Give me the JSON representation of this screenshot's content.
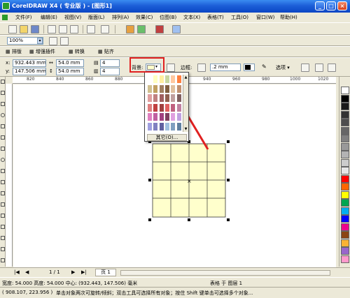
{
  "window": {
    "title": "CorelDRAW X4 ( 专业版 ) - [图形1]",
    "min_label": "_",
    "max_label": "□",
    "close_label": "×"
  },
  "menu": [
    {
      "label": "文件(F)",
      "name": "menu-file"
    },
    {
      "label": "编辑(E)",
      "name": "menu-edit"
    },
    {
      "label": "视图(V)",
      "name": "menu-view"
    },
    {
      "label": "版面(L)",
      "name": "menu-layout"
    },
    {
      "label": "排列(A)",
      "name": "menu-arrange"
    },
    {
      "label": "效果(C)",
      "name": "menu-effects"
    },
    {
      "label": "位图(B)",
      "name": "menu-bitmaps"
    },
    {
      "label": "文本(X)",
      "name": "menu-text"
    },
    {
      "label": "表格(T)",
      "name": "menu-table"
    },
    {
      "label": "工具(O)",
      "name": "menu-tools"
    },
    {
      "label": "窗口(W)",
      "name": "menu-window"
    },
    {
      "label": "帮助(H)",
      "name": "menu-help"
    }
  ],
  "zoom": {
    "value": "100%"
  },
  "table_toolbar": {
    "btn1": "排版",
    "btn2": "增强插件",
    "btn3": "转换",
    "btn4": "贴齐"
  },
  "property_bar": {
    "x_label": "x:",
    "x_value": "932.443 mm",
    "y_label": "y:",
    "y_value": "147.506 mm",
    "w_value": "54.0 mm",
    "h_value": "54.0 mm",
    "rows": "4",
    "cols": "4",
    "background_label": "背景:",
    "border_label": "边框:",
    "border_width": ".2 mm",
    "options_label": "选项"
  },
  "picker": {
    "colors": [
      "#ffffff",
      "#ffffc0",
      "#fff0a0",
      "#c8d8a0",
      "#ffc8a0",
      "#ff8040",
      "#d0c090",
      "#c0a060",
      "#a08060",
      "#806040",
      "#e0c0a0",
      "#c09070",
      "#e0a0a0",
      "#c08080",
      "#a06060",
      "#906050",
      "#c0a0a0",
      "#806060",
      "#e08080",
      "#c04040",
      "#a04040",
      "#e06060",
      "#c06080",
      "#c080a0",
      "#e080c0",
      "#c060a0",
      "#a04080",
      "#804060",
      "#e0a0e0",
      "#c0a0e0",
      "#a0a0e0",
      "#8080c0",
      "#6060a0",
      "#a0c0e0",
      "#80a0c0",
      "#6080a0"
    ],
    "other_label": "其它(O)..."
  },
  "table_grid": {
    "rows": 4,
    "cols": 4,
    "fill": "#ffffcc"
  },
  "rulers": {
    "h_labels": [
      "820",
      "840",
      "860",
      "880",
      "900",
      "920",
      "940",
      "960",
      "980",
      "1000",
      "1020"
    ],
    "v_label": "毫米"
  },
  "palette_colors": [
    "#ffffff",
    "#000000",
    "#1a1a1a",
    "#333333",
    "#4d4d4d",
    "#666666",
    "#808080",
    "#999999",
    "#b3b3b3",
    "#cccccc",
    "#e6e6e6",
    "#ff0000",
    "#ff6600",
    "#ffff00",
    "#00a651",
    "#00aeef",
    "#0000ff",
    "#ec008c",
    "#8b4513",
    "#f9b234",
    "#9966cc",
    "#ff99cc"
  ],
  "pagebar": {
    "page_info": "1 / 1",
    "page_tab": "页 1"
  },
  "status": {
    "size_text": "宽度: 54.000 高度: 54.000 中心: (932.443, 147.506) 毫米",
    "layer_text": "表格 于 图层 1",
    "coords_text": "( 908.107, 223.956 )",
    "hint_text": "单击对象两次可旋转/倾斜；双击工具可选择所有对象；按住 Shift 键单击可选择多个对象..."
  },
  "colors": {
    "highlight": "#e02020",
    "arrow": "#e02020"
  }
}
